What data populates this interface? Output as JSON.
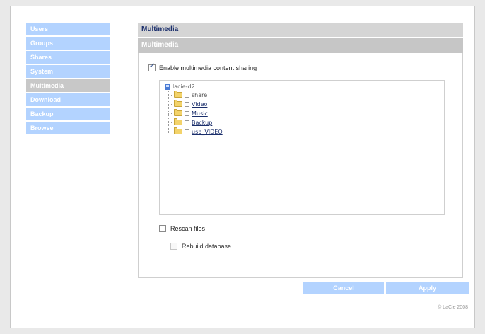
{
  "sidebar": {
    "items": [
      {
        "label": "Users",
        "active": false
      },
      {
        "label": "Groups",
        "active": false
      },
      {
        "label": "Shares",
        "active": false
      },
      {
        "label": "System",
        "active": false
      },
      {
        "label": "Multimedia",
        "active": true
      },
      {
        "label": "Download",
        "active": false
      },
      {
        "label": "Backup",
        "active": false
      },
      {
        "label": "Browse",
        "active": false
      }
    ]
  },
  "main": {
    "header_title": "Multimedia",
    "section_title": "Multimedia",
    "enable_sharing": {
      "label": "Enable multimedia content sharing",
      "checked": true
    },
    "tree": {
      "root": "lacie-d2",
      "items": [
        {
          "label": "share",
          "link": false
        },
        {
          "label": "Video",
          "link": true
        },
        {
          "label": "Music",
          "link": true
        },
        {
          "label": "Backup",
          "link": true
        },
        {
          "label": "usb_VIDEO",
          "link": true
        }
      ]
    },
    "rescan": {
      "label": "Rescan files",
      "checked": false
    },
    "rebuild": {
      "label": "Rebuild database",
      "checked": false,
      "disabled": true
    }
  },
  "buttons": {
    "cancel": "Cancel",
    "apply": "Apply"
  },
  "footer": {
    "copyright": "© LaCie 2008"
  },
  "colors": {
    "nav": "#b3d3ff",
    "nav_active": "#c8c8c8",
    "header_text": "#1a2e6b"
  }
}
